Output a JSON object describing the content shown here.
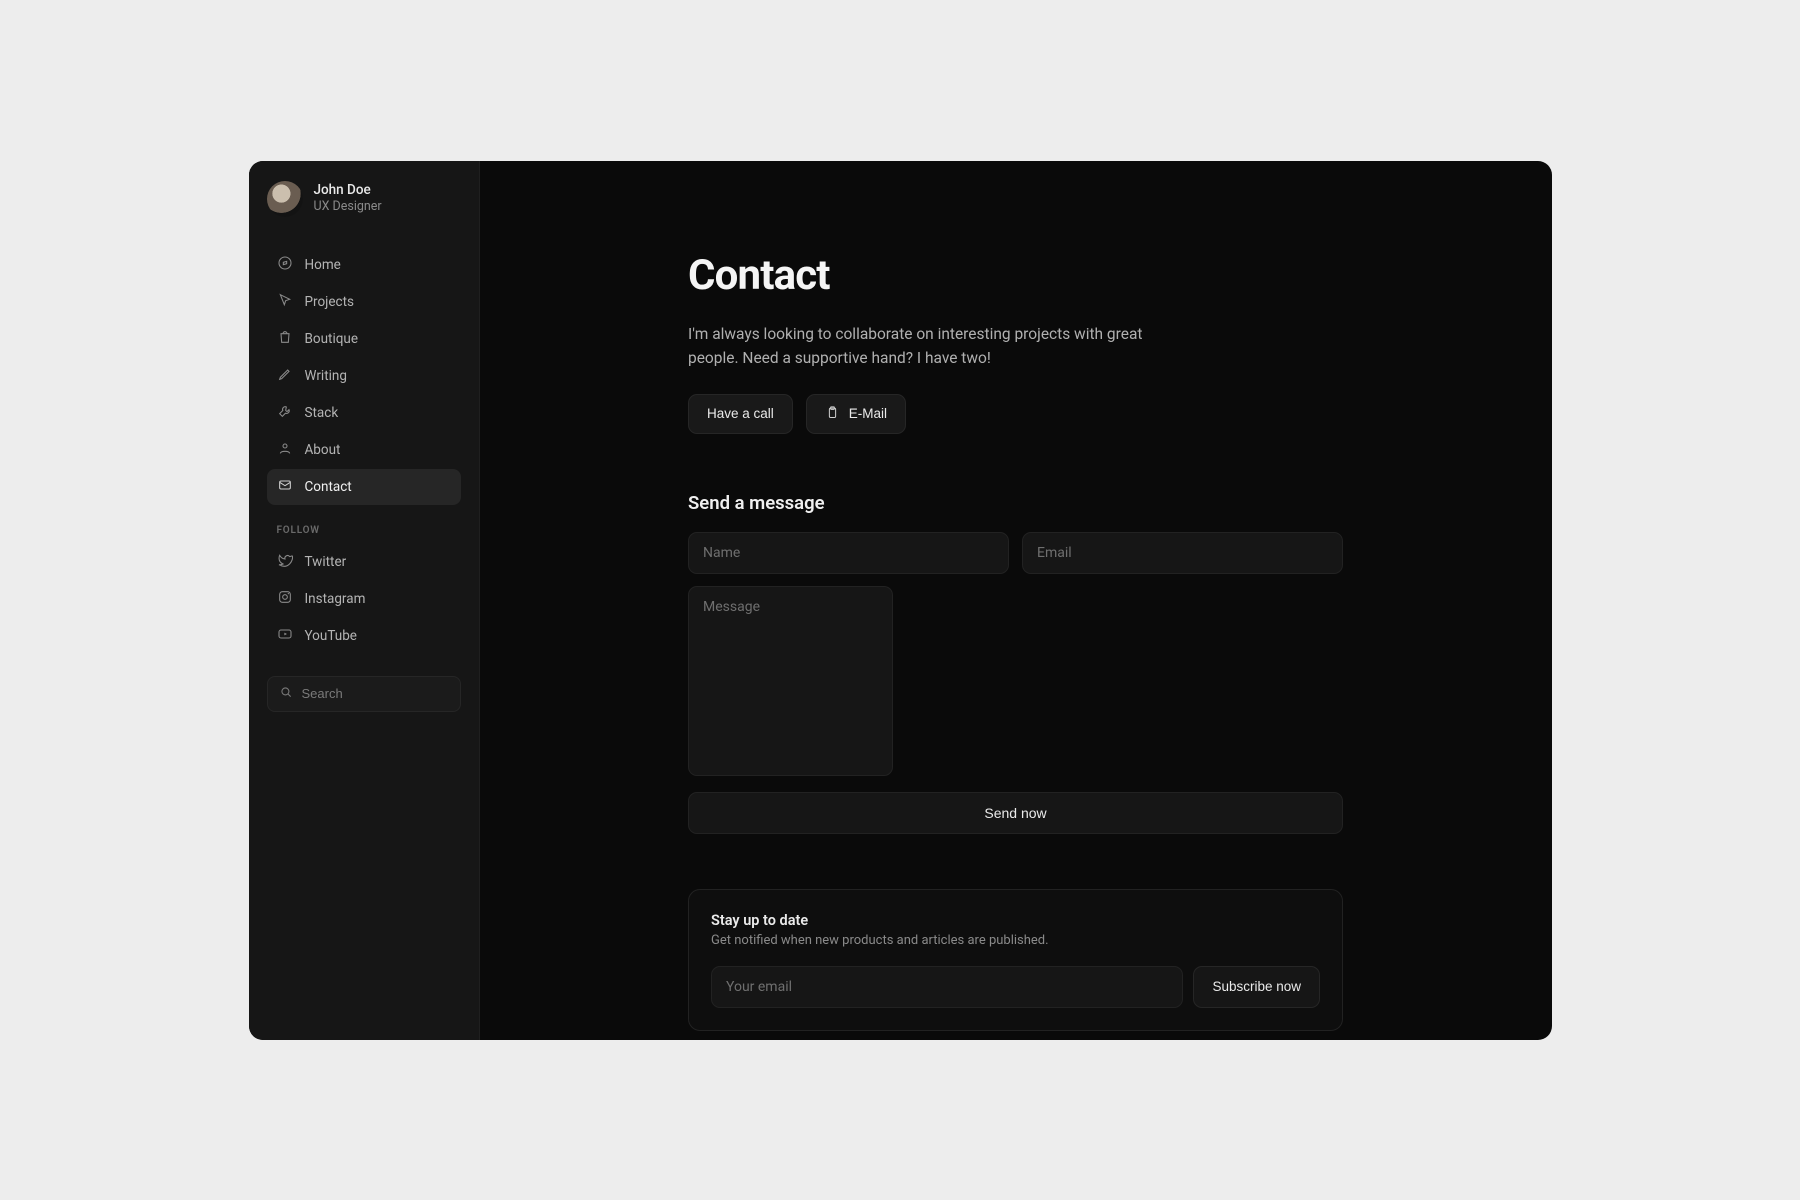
{
  "profile": {
    "name": "John Doe",
    "role": "UX Designer"
  },
  "nav": {
    "items": [
      {
        "label": "Home"
      },
      {
        "label": "Projects"
      },
      {
        "label": "Boutique"
      },
      {
        "label": "Writing"
      },
      {
        "label": "Stack"
      },
      {
        "label": "About"
      },
      {
        "label": "Contact"
      }
    ],
    "active_index": 6
  },
  "follow": {
    "label": "FOLLOW",
    "items": [
      {
        "label": "Twitter"
      },
      {
        "label": "Instagram"
      },
      {
        "label": "YouTube"
      }
    ]
  },
  "search": {
    "placeholder": "Search"
  },
  "page": {
    "title": "Contact",
    "subtitle": "I'm always looking to collaborate on interesting projects with great people. Need a supportive hand? I have two!"
  },
  "actions": {
    "call_label": "Have a call",
    "email_label": "E-Mail"
  },
  "form": {
    "title": "Send a message",
    "name_placeholder": "Name",
    "email_placeholder": "Email",
    "message_placeholder": "Message",
    "submit_label": "Send now"
  },
  "subscribe": {
    "title": "Stay up to date",
    "subtitle": "Get notified when new products and articles are published.",
    "email_placeholder": "Your email",
    "button_label": "Subscribe now"
  }
}
